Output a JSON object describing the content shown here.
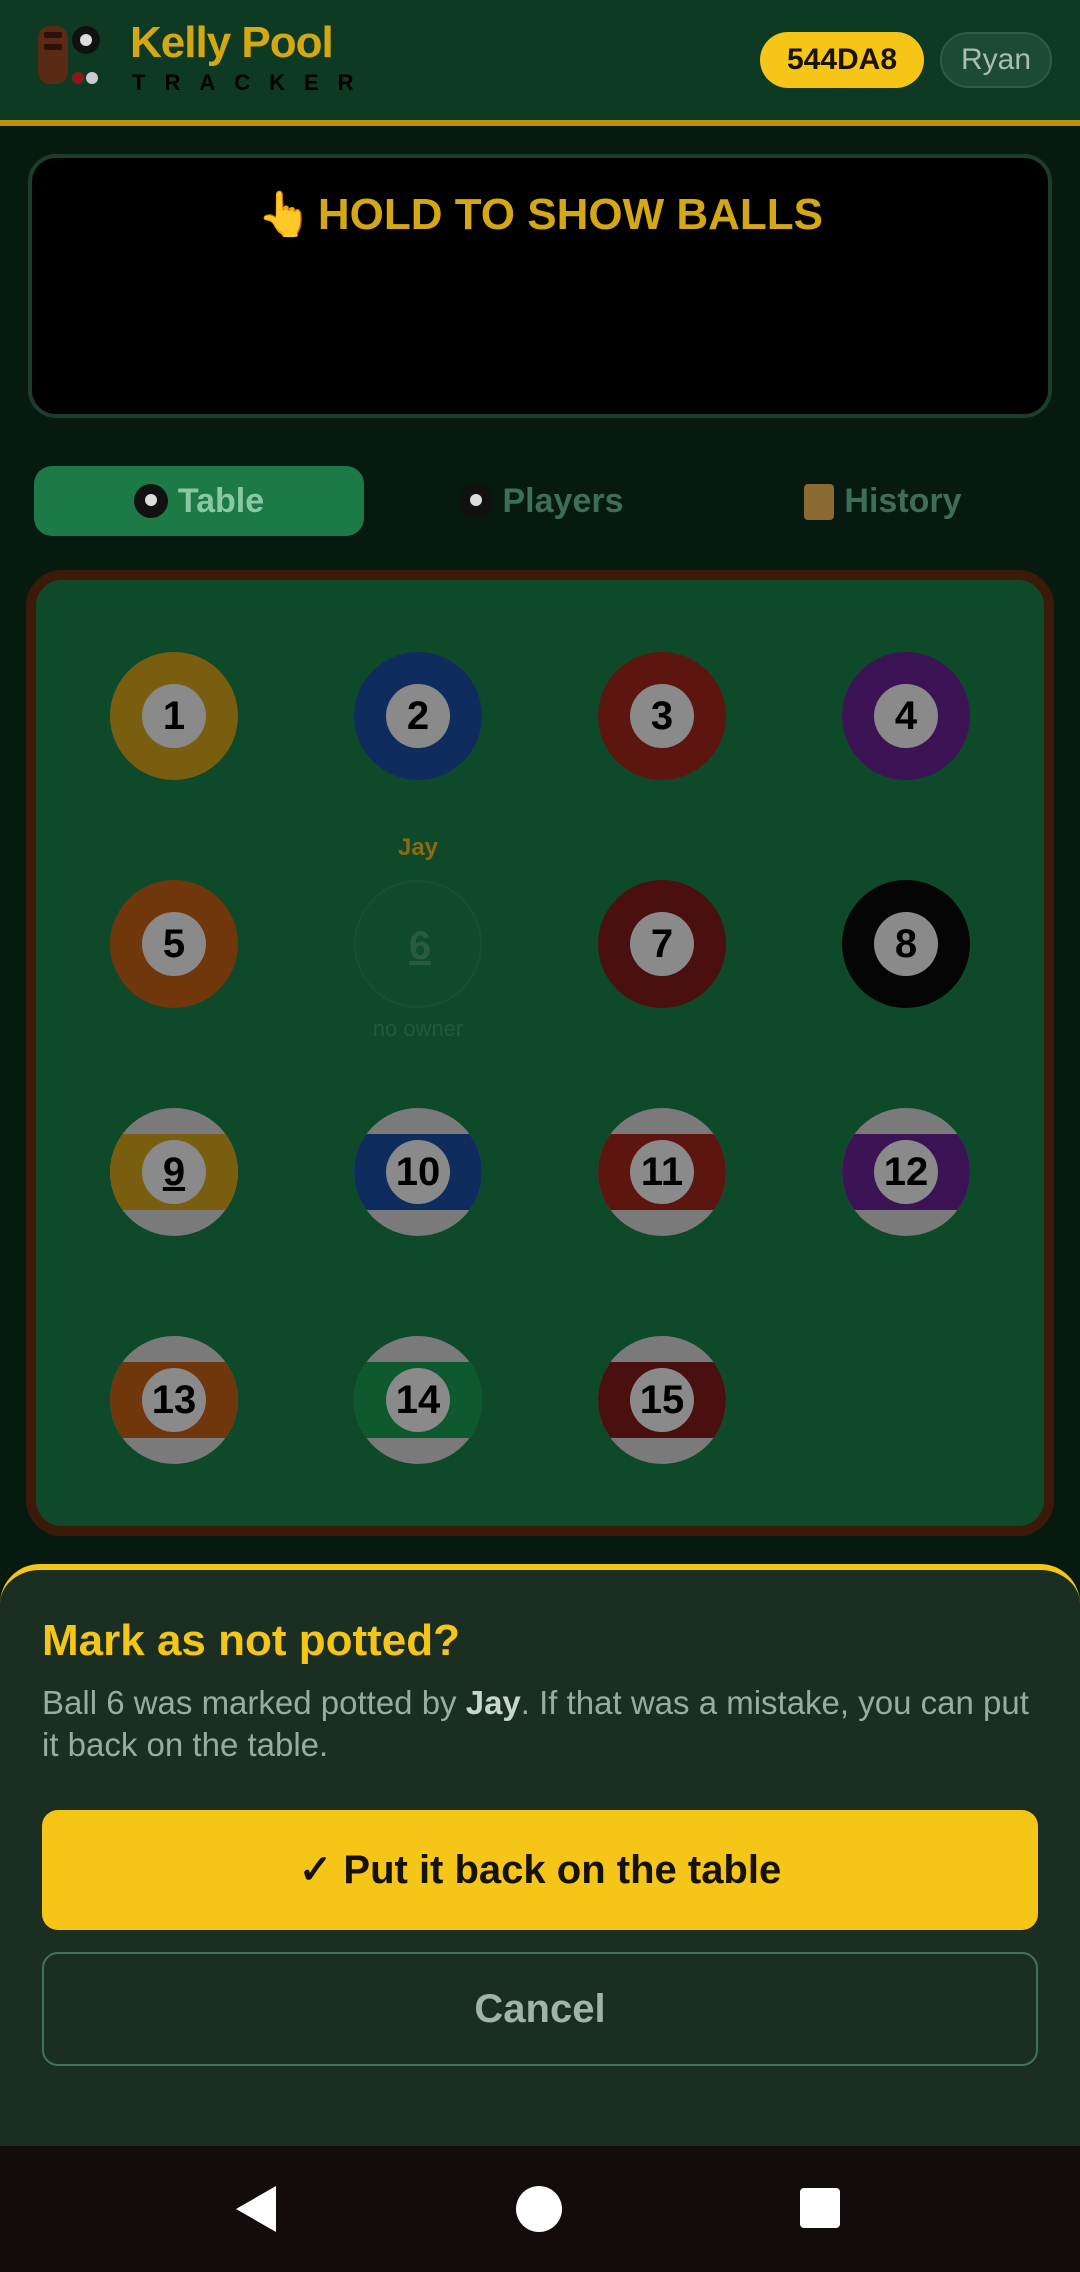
{
  "header": {
    "brand_title": "Kelly Pool",
    "brand_sub": "TRACKER",
    "room_code": "544DA8",
    "user": "Ryan"
  },
  "hold_panel": {
    "label": "HOLD TO SHOW BALLS",
    "icon": "pointing-hand-icon"
  },
  "tabs": [
    {
      "label": "Table",
      "icon": "eight-ball-icon",
      "active": true
    },
    {
      "label": "Players",
      "icon": "eight-ball-icon",
      "active": false
    },
    {
      "label": "History",
      "icon": "scroll-icon",
      "active": false
    }
  ],
  "balls": [
    {
      "number": "1",
      "color": "#7a5e10",
      "stripe": false
    },
    {
      "number": "2",
      "color": "#0f2c5e",
      "stripe": false
    },
    {
      "number": "3",
      "color": "#5c160f",
      "stripe": false
    },
    {
      "number": "4",
      "color": "#3c1355",
      "stripe": false
    },
    {
      "number": "5",
      "color": "#70360c",
      "stripe": false
    },
    {
      "number": "6",
      "color": "#0f4a2b",
      "stripe": false,
      "potted": true,
      "owner": "Jay",
      "owner_note": "no owner"
    },
    {
      "number": "7",
      "color": "#4a0f0f",
      "stripe": false
    },
    {
      "number": "8",
      "color": "#050505",
      "stripe": false
    },
    {
      "number": "9",
      "color": "#7a5e10",
      "stripe": true
    },
    {
      "number": "10",
      "color": "#0f2c5e",
      "stripe": true
    },
    {
      "number": "11",
      "color": "#5c160f",
      "stripe": true
    },
    {
      "number": "12",
      "color": "#3c1355",
      "stripe": true
    },
    {
      "number": "13",
      "color": "#70360c",
      "stripe": true
    },
    {
      "number": "14",
      "color": "#0e5a2e",
      "stripe": true
    },
    {
      "number": "15",
      "color": "#4a0f0f",
      "stripe": true
    }
  ],
  "sheet": {
    "title": "Mark as not potted?",
    "message_pre": "Ball 6 was marked potted by ",
    "message_name": "Jay",
    "message_post": ". If that was a mistake, you can put it back on the table.",
    "confirm_label": "✓ Put it back on the table",
    "cancel_label": "Cancel"
  },
  "colors": {
    "accent": "#f5c518",
    "felt": "#0e4a2a",
    "rail": "#3c1a0a"
  }
}
